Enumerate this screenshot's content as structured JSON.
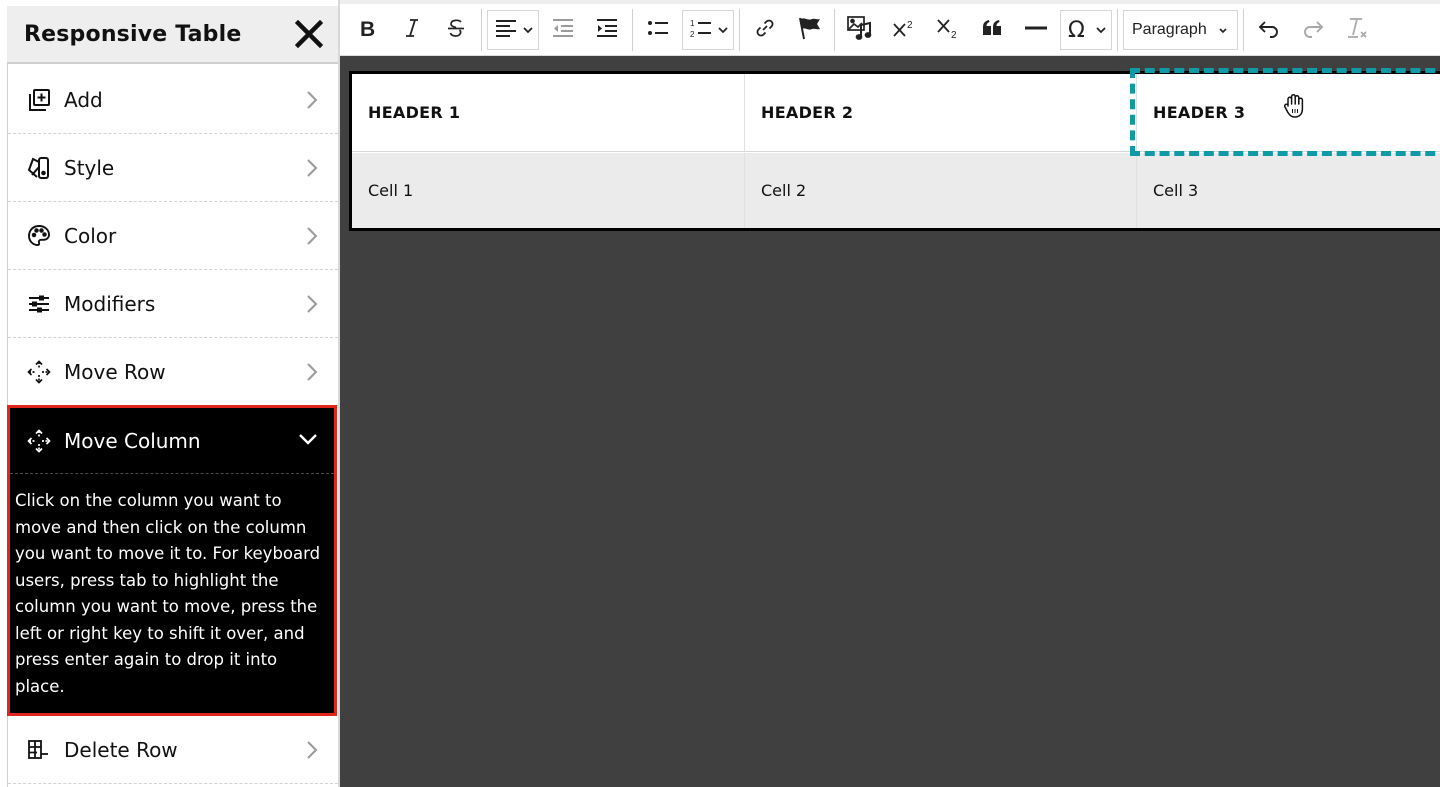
{
  "sidebar": {
    "title": "Responsive Table",
    "close_icon": "close-icon",
    "items": [
      {
        "label": "Add",
        "icon": "add-icon"
      },
      {
        "label": "Style",
        "icon": "style-icon"
      },
      {
        "label": "Color",
        "icon": "palette-icon"
      },
      {
        "label": "Modifiers",
        "icon": "sliders-icon"
      },
      {
        "label": "Move Row",
        "icon": "move-icon"
      }
    ],
    "active_item": {
      "label": "Move Column",
      "icon": "move-icon",
      "expanded": true,
      "description": "Click on the column you want to move and then click on the column you want to move it to. For keyboard users, press tab to highlight the column you want to move, press the left or right key to shift it over, and press enter again to drop it into place."
    },
    "after_items": [
      {
        "label": "Delete Row",
        "icon": "delete-row-icon"
      }
    ],
    "accent_color": "#e0261b"
  },
  "toolbar": {
    "buttons": [
      {
        "name": "bold",
        "icon": "bold-icon"
      },
      {
        "name": "italic",
        "icon": "italic-icon"
      },
      {
        "name": "strikethrough",
        "icon": "strikethrough-icon"
      },
      {
        "name": "align",
        "icon": "align-left-icon",
        "dropdown": true
      },
      {
        "name": "outdent",
        "icon": "outdent-icon",
        "disabled": true
      },
      {
        "name": "indent",
        "icon": "indent-icon"
      },
      {
        "name": "bullet-list",
        "icon": "bullet-list-icon"
      },
      {
        "name": "numbered-list",
        "icon": "numbered-list-icon",
        "dropdown": true
      },
      {
        "name": "link",
        "icon": "link-icon"
      },
      {
        "name": "anchor",
        "icon": "flag-icon"
      },
      {
        "name": "media",
        "icon": "media-icon"
      },
      {
        "name": "superscript",
        "icon": "superscript-icon"
      },
      {
        "name": "subscript",
        "icon": "subscript-icon"
      },
      {
        "name": "blockquote",
        "icon": "quote-icon"
      },
      {
        "name": "horizontal-rule",
        "icon": "horizontal-rule-icon"
      },
      {
        "name": "special-char",
        "icon": "omega-icon",
        "dropdown": true
      },
      {
        "name": "undo",
        "icon": "undo-icon"
      },
      {
        "name": "redo",
        "icon": "redo-icon",
        "disabled": true
      },
      {
        "name": "clear-formatting",
        "icon": "clear-format-icon",
        "disabled": true
      }
    ],
    "format_select": {
      "value": "Paragraph"
    }
  },
  "table": {
    "headers": [
      "HEADER 1",
      "HEADER 2",
      "HEADER 3"
    ],
    "rows": [
      [
        "Cell 1",
        "Cell 2",
        "Cell 3"
      ]
    ],
    "selected_column_index": 2,
    "highlight_color": "#0f9aa8"
  }
}
